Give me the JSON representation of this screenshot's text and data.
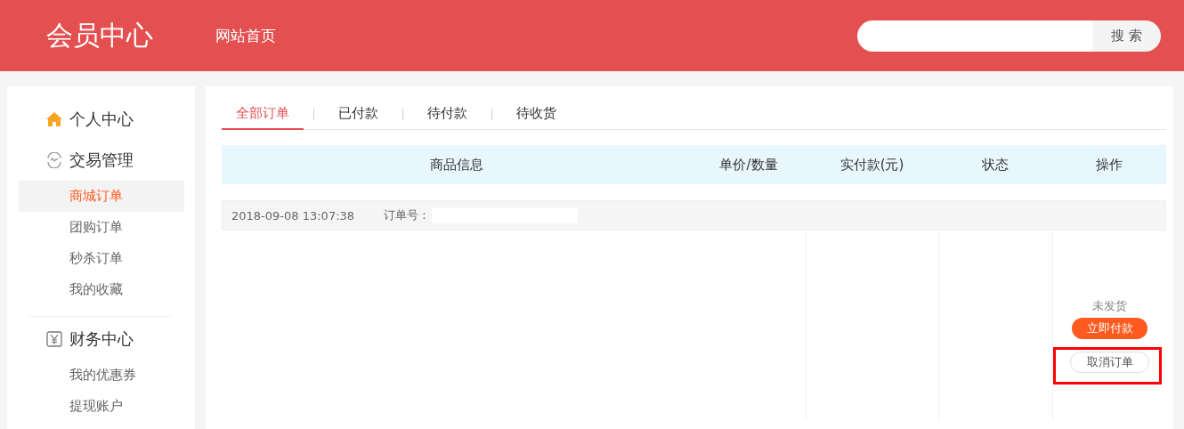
{
  "header": {
    "title": "会员中心",
    "nav_link": "网站首页",
    "search": {
      "button": "搜 索"
    }
  },
  "sidebar": {
    "sections": [
      {
        "kind": "home",
        "title": "个人中心"
      },
      {
        "kind": "trade",
        "title": "交易管理",
        "items": [
          {
            "label": "商城订单",
            "selected": true
          },
          {
            "label": "团购订单",
            "selected": false
          },
          {
            "label": "秒杀订单",
            "selected": false
          },
          {
            "label": "我的收藏",
            "selected": false
          }
        ]
      },
      {
        "kind": "finance",
        "title": "财务中心",
        "items": [
          {
            "label": "我的优惠券",
            "selected": false
          },
          {
            "label": "提现账户",
            "selected": false
          }
        ]
      }
    ]
  },
  "tabs": [
    {
      "label": "全部订单",
      "selected": true
    },
    {
      "label": "已付款",
      "selected": false
    },
    {
      "label": "待付款",
      "selected": false
    },
    {
      "label": "待收货",
      "selected": false
    }
  ],
  "table": {
    "columns": [
      "商品信息",
      "单价/数量",
      "实付款(元)",
      "状态",
      "操作"
    ]
  },
  "orders": [
    {
      "time": "2018-09-08 13:07:38",
      "order_no_label": "订单号：",
      "status": "未发货",
      "actions": [
        {
          "kind": "primary",
          "label": "立即付款",
          "highlighted": false
        },
        {
          "kind": "secondary",
          "label": "取消订单",
          "highlighted": true
        }
      ]
    }
  ]
}
